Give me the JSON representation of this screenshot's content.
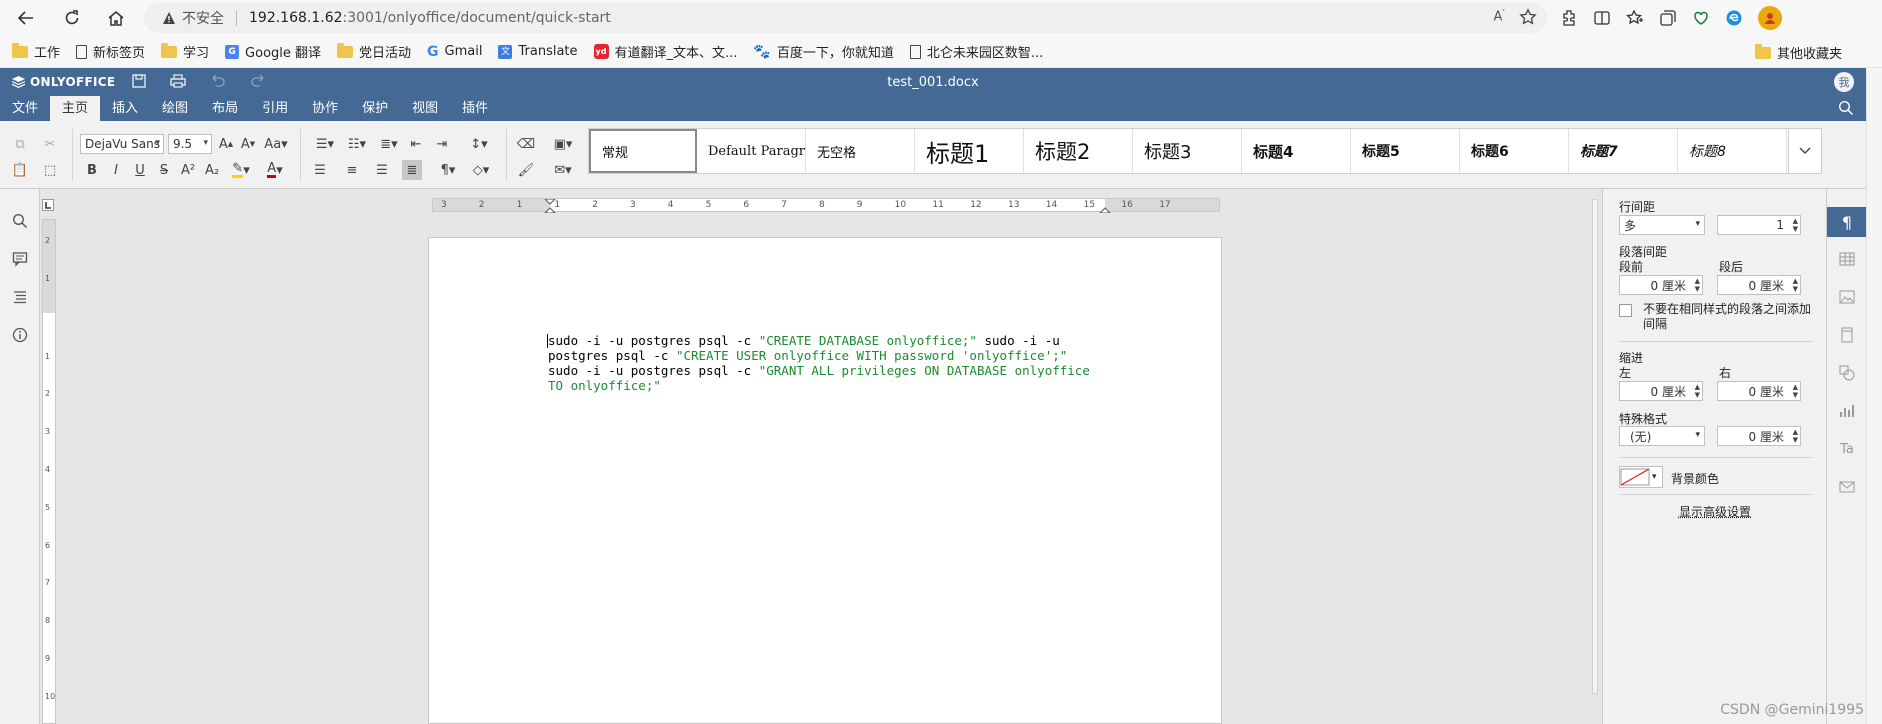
{
  "browser": {
    "security_label": "不安全",
    "url_host": "192.168.1.62",
    "url_rest": ":3001/onlyoffice/document/quick-start",
    "bookmarks": [
      {
        "label": "工作",
        "icon": "folder-icon"
      },
      {
        "label": "新标签页",
        "icon": "page-icon"
      },
      {
        "label": "学习",
        "icon": "folder-icon"
      },
      {
        "label": "Google 翻译",
        "icon": "google-translate-icon"
      },
      {
        "label": "党日活动",
        "icon": "folder-icon"
      },
      {
        "label": "Gmail",
        "icon": "google-icon"
      },
      {
        "label": "Translate",
        "icon": "translate-icon"
      },
      {
        "label": "有道翻译_文本、文...",
        "icon": "youdao-icon"
      },
      {
        "label": "百度一下，你就知道",
        "icon": "baidu-icon"
      },
      {
        "label": "北仑未来园区数智...",
        "icon": "page-icon"
      }
    ],
    "other_bookmarks": "其他收藏夹"
  },
  "editor": {
    "brand": "ONLYOFFICE",
    "doc_title": "test_001.docx",
    "user_initial": "我",
    "tabs": [
      "文件",
      "主页",
      "插入",
      "绘图",
      "布局",
      "引用",
      "协作",
      "保护",
      "视图",
      "插件"
    ],
    "active_tab": "主页",
    "font_name": "DejaVu Sans",
    "font_size": "9.5",
    "styles": [
      "常规",
      "Default Paragra",
      "无空格",
      "标题1",
      "标题2",
      "标题3",
      "标题4",
      "标题5",
      "标题6",
      "标题7",
      "标题8"
    ]
  },
  "document": {
    "line1_a": "sudo -i -u postgres psql -c ",
    "line1_b": "\"CREATE DATABASE onlyoffice;\"",
    "line1_c": " sudo -i -u",
    "line2_a": "postgres psql -c ",
    "line2_b": "\"CREATE USER onlyoffice WITH password 'onlyoffice';\"",
    "line3_a": "sudo -i -u postgres psql -c ",
    "line3_b": "\"GRANT ALL privileges ON DATABASE onlyoffice",
    "line4_b": "TO onlyoffice;\""
  },
  "ruler": {
    "h_labels": [
      "3",
      "2",
      "1",
      "1",
      "2",
      "3",
      "4",
      "5",
      "6",
      "7",
      "8",
      "9",
      "10",
      "11",
      "12",
      "13",
      "14",
      "15",
      "16",
      "17"
    ],
    "v_labels": [
      "2",
      "1",
      "1",
      "2",
      "3",
      "4",
      "5",
      "6",
      "7",
      "8",
      "9",
      "10"
    ]
  },
  "paragraph_panel": {
    "line_spacing_label": "行间距",
    "line_spacing_mode": "多",
    "line_spacing_value": "1",
    "para_spacing_label": "段落间距",
    "before_label": "段前",
    "after_label": "段后",
    "before_value": "0 厘米",
    "after_value": "0 厘米",
    "no_space_label": "不要在相同样式的段落之间添加间隔",
    "indent_label": "缩进",
    "left_label": "左",
    "right_label": "右",
    "left_value": "0 厘米",
    "right_value": "0 厘米",
    "special_label": "特殊格式",
    "special_value": "(无)",
    "special_amount": "0 厘米",
    "bg_color_label": "背景颜色",
    "advanced_link": "显示高级设置"
  },
  "watermark": "CSDN @Gemini1995"
}
